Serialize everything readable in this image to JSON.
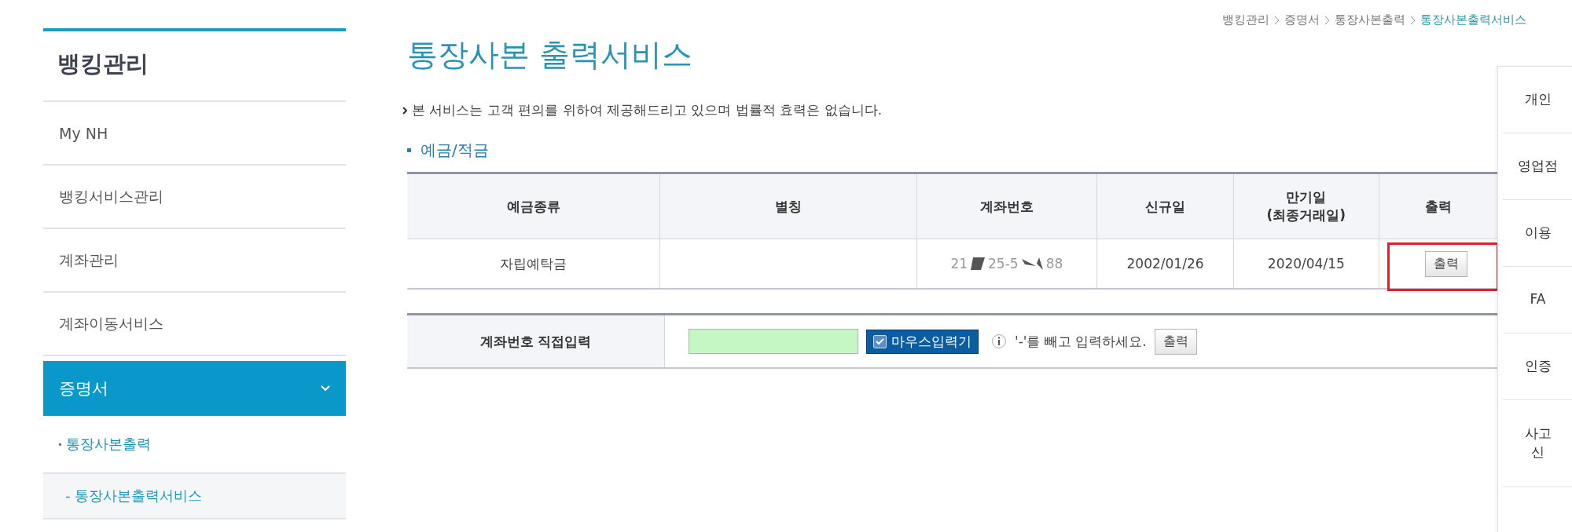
{
  "sidebar": {
    "title": "뱅킹관리",
    "items": [
      {
        "label": "My NH",
        "selected": false
      },
      {
        "label": "뱅킹서비스관리",
        "selected": false
      },
      {
        "label": "계좌관리",
        "selected": false
      },
      {
        "label": "계좌이동서비스",
        "selected": false
      },
      {
        "label": "증명서",
        "selected": true,
        "expanded": true,
        "children": [
          {
            "label": "통장사본출력",
            "selected": true,
            "children": [
              {
                "label": "- 통장사본출력서비스",
                "selected": true
              }
            ]
          }
        ]
      }
    ]
  },
  "breadcrumb": [
    {
      "label": "뱅킹관리",
      "current": false
    },
    {
      "label": "증명서",
      "current": false
    },
    {
      "label": "통장사본출력",
      "current": false
    },
    {
      "label": "통장사본출력서비스",
      "current": true
    }
  ],
  "page_title": "통장사본 출력서비스",
  "notice": "본 서비스는 고객 편의를 위하여 제공해드리고 있으며 법률적 효력은 없습니다.",
  "section_title": "예금/적금",
  "accounts_table": {
    "columns": [
      {
        "lines": [
          "예금종류"
        ]
      },
      {
        "lines": [
          "별칭"
        ]
      },
      {
        "lines": [
          "계좌번호"
        ]
      },
      {
        "lines": [
          "신규일"
        ]
      },
      {
        "lines": [
          "만기일",
          "(최종거래일)"
        ]
      },
      {
        "lines": [
          "출력"
        ]
      }
    ],
    "rows": [
      {
        "type": "자립예탁금",
        "account_parts": [
          "21",
          "25-5",
          "88"
        ],
        "opened": "2002/01/26",
        "maturity": "2020/04/15",
        "button": "출력",
        "highlighted": true
      }
    ]
  },
  "direct_input": {
    "label": "계좌번호 직접입력",
    "mouse_input": {
      "label": "마우스입력기",
      "checked": true
    },
    "hint": "'-'를 빼고 입력하세요.",
    "button": "출력"
  },
  "quick_menu": [
    {
      "lines": [
        "개인"
      ]
    },
    {
      "lines": [
        "영업점"
      ]
    },
    {
      "lines": [
        "이용"
      ]
    },
    {
      "lines": [
        "FA"
      ]
    },
    {
      "lines": [
        "인증"
      ]
    },
    {
      "lines": [
        "사고",
        "신"
      ]
    }
  ]
}
